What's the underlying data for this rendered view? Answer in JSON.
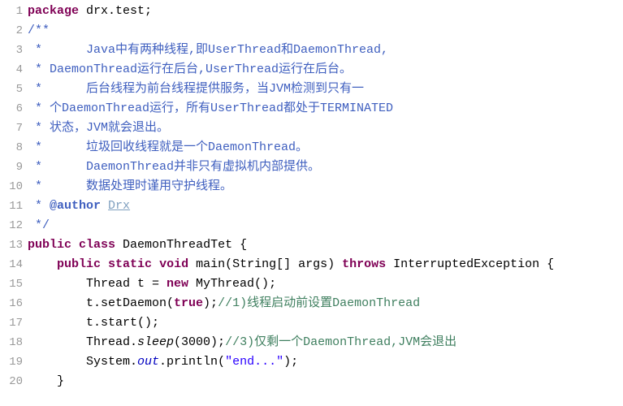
{
  "lines": [
    {
      "n": "1",
      "segs": [
        {
          "t": "package",
          "c": "kw"
        },
        {
          "t": " ",
          "c": ""
        },
        {
          "t": "drx.test;",
          "c": "pkg"
        }
      ]
    },
    {
      "n": "2",
      "segs": [
        {
          "t": "/**",
          "c": "doc"
        }
      ]
    },
    {
      "n": "3",
      "segs": [
        {
          "t": " *      Java中有两种线程,即UserThread和DaemonThread,",
          "c": "doc"
        }
      ]
    },
    {
      "n": "4",
      "segs": [
        {
          "t": " * DaemonThread运行在后台,UserThread运行在后台。",
          "c": "doc"
        }
      ]
    },
    {
      "n": "5",
      "segs": [
        {
          "t": " *      后台线程为前台线程提供服务，当JVM检测到只有一",
          "c": "doc"
        }
      ]
    },
    {
      "n": "6",
      "segs": [
        {
          "t": " * 个DaemonThread运行，所有UserThread都处于TERMINATED",
          "c": "doc"
        }
      ]
    },
    {
      "n": "7",
      "segs": [
        {
          "t": " * 状态，JVM就会退出。",
          "c": "doc"
        }
      ]
    },
    {
      "n": "8",
      "segs": [
        {
          "t": " *      垃圾回收线程就是一个DaemonThread。",
          "c": "doc"
        }
      ]
    },
    {
      "n": "9",
      "segs": [
        {
          "t": " *      DaemonThread并非只有虚拟机内部提供。",
          "c": "doc"
        }
      ]
    },
    {
      "n": "10",
      "segs": [
        {
          "t": " *      数据处理时谨用守护线程。",
          "c": "doc"
        }
      ]
    },
    {
      "n": "11",
      "segs": [
        {
          "t": " * ",
          "c": "doc"
        },
        {
          "t": "@author",
          "c": "doctag"
        },
        {
          "t": " ",
          "c": "doc"
        },
        {
          "t": "Drx",
          "c": "docline"
        }
      ]
    },
    {
      "n": "12",
      "segs": [
        {
          "t": " */",
          "c": "doc"
        }
      ]
    },
    {
      "n": "13",
      "segs": [
        {
          "t": "public",
          "c": "kw"
        },
        {
          "t": " ",
          "c": ""
        },
        {
          "t": "class",
          "c": "kw"
        },
        {
          "t": " DaemonThreadTet {",
          "c": "ident"
        }
      ]
    },
    {
      "n": "14",
      "segs": [
        {
          "t": "    ",
          "c": ""
        },
        {
          "t": "public",
          "c": "kw"
        },
        {
          "t": " ",
          "c": ""
        },
        {
          "t": "static",
          "c": "kw"
        },
        {
          "t": " ",
          "c": ""
        },
        {
          "t": "void",
          "c": "kw"
        },
        {
          "t": " main(String[] args) ",
          "c": "ident"
        },
        {
          "t": "throws",
          "c": "kw"
        },
        {
          "t": " InterruptedException {",
          "c": "ident"
        }
      ]
    },
    {
      "n": "15",
      "segs": [
        {
          "t": "        Thread t = ",
          "c": "ident"
        },
        {
          "t": "new",
          "c": "kw"
        },
        {
          "t": " MyThread();",
          "c": "ident"
        }
      ]
    },
    {
      "n": "16",
      "segs": [
        {
          "t": "        t.setDaemon(",
          "c": "ident"
        },
        {
          "t": "true",
          "c": "kw"
        },
        {
          "t": ");",
          "c": "ident"
        },
        {
          "t": "//1)线程启动前设置DaemonThread",
          "c": "cmt"
        }
      ]
    },
    {
      "n": "17",
      "segs": [
        {
          "t": "        t.start();",
          "c": "ident"
        }
      ]
    },
    {
      "n": "18",
      "segs": [
        {
          "t": "        Thread.",
          "c": "ident"
        },
        {
          "t": "sleep",
          "c": "staticm"
        },
        {
          "t": "(3000);",
          "c": "ident"
        },
        {
          "t": "//3)仅剩一个DaemonThread,JVM会退出",
          "c": "cmt"
        }
      ]
    },
    {
      "n": "19",
      "segs": [
        {
          "t": "        System.",
          "c": "ident"
        },
        {
          "t": "out",
          "c": "field"
        },
        {
          "t": ".println(",
          "c": "ident"
        },
        {
          "t": "\"end...\"",
          "c": "str"
        },
        {
          "t": ");",
          "c": "ident"
        }
      ]
    },
    {
      "n": "20",
      "segs": [
        {
          "t": "    }",
          "c": "ident"
        }
      ]
    }
  ]
}
